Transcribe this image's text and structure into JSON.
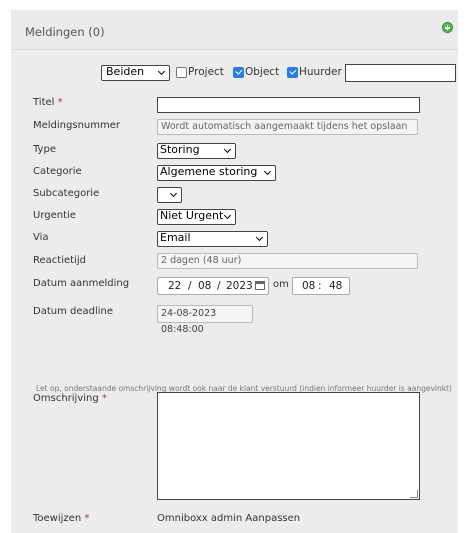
{
  "header": {
    "title": "Meldingen (0)",
    "add_icon": "plus-circle-icon"
  },
  "filters": {
    "scope_selected": "Beiden",
    "project_label": "Project",
    "project_checked": false,
    "object_label": "Object",
    "object_checked": true,
    "huurder_label": "Huurder",
    "huurder_checked": true,
    "search_value": ""
  },
  "form": {
    "titel": {
      "label": "Titel",
      "required": "*",
      "value": ""
    },
    "meldingsnummer": {
      "label": "Meldingsnummer",
      "value": "Wordt automatisch aangemaakt tijdens het opslaan"
    },
    "type": {
      "label": "Type",
      "selected": "Storing"
    },
    "categorie": {
      "label": "Categorie",
      "selected": "Algemene storing"
    },
    "subcategorie": {
      "label": "Subcategorie",
      "selected": ""
    },
    "urgentie": {
      "label": "Urgentie",
      "selected": "Niet Urgent"
    },
    "via": {
      "label": "Via",
      "selected": "Email"
    },
    "reactietijd": {
      "label": "Reactietijd",
      "value": "2 dagen (48 uur)"
    },
    "datum_aanmelding": {
      "label": "Datum aanmelding",
      "day": "22",
      "month": "08",
      "year": "2023",
      "sep": "/",
      "om": "om",
      "hour": "08",
      "minute": "48",
      "time_sep": ":"
    },
    "datum_deadline": {
      "label": "Datum deadline",
      "value": "24-08-2023 08:48:00"
    },
    "note": "Let op, onderstaande omschrijving wordt ook naar de klant verstuurd (indien informeer huurder is aangevinkt)",
    "omschrijving": {
      "label": "Omschrijving",
      "required": "*",
      "value": ""
    },
    "toewijzen": {
      "label": "Toewijzen",
      "required": "*",
      "value": "Omniboxx admin",
      "action": "Aanpassen"
    }
  }
}
